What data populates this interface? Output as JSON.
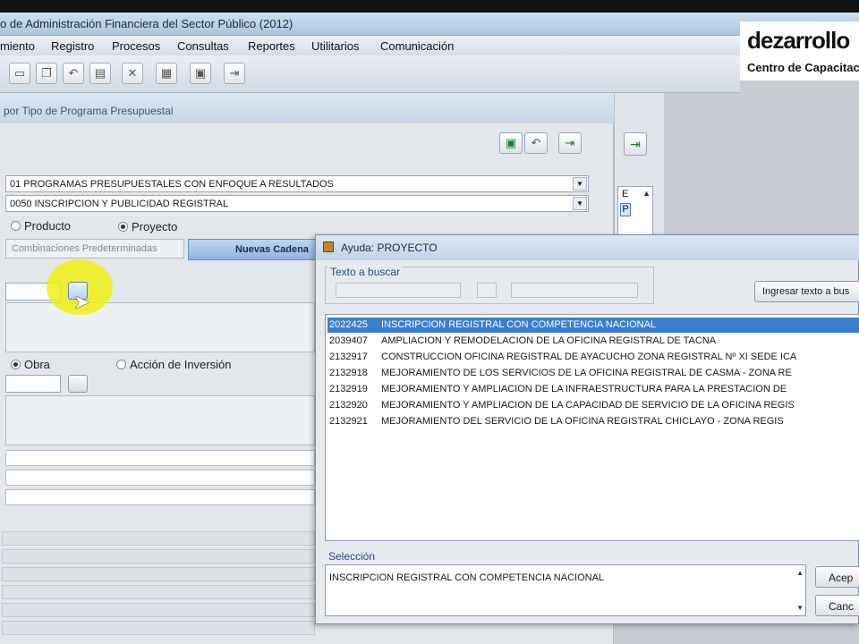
{
  "window": {
    "title": "o de Administración Financiera del Sector Público (2012)"
  },
  "menu": [
    "miento",
    "Registro",
    "Procesos",
    "Consultas",
    "Reportes",
    "Utilitarios",
    "Comunicación"
  ],
  "logo": {
    "name": "dezarrollo",
    "tagline": "Centro de Capacitaci"
  },
  "form": {
    "title": "por Tipo de Programa Presupuestal",
    "combo1": "01 PROGRAMAS PRESUPUESTALES CON ENFOQUE A RESULTADOS",
    "combo2": "0050 INSCRIPCION Y PUBLICIDAD REGISTRAL",
    "radio_producto": "Producto",
    "radio_proyecto": "Proyecto",
    "tab_combinaciones": "Combinaciones Predeterminadas",
    "tab_nuevas": "Nuevas Cadena",
    "radio_obra": "Obra",
    "radio_accion": "Acción de Inversión"
  },
  "side": {
    "letter1": "E",
    "letter2": "P"
  },
  "dialog": {
    "title": "Ayuda: PROYECTO",
    "search_label": "Texto a buscar",
    "search_button": "Ingresar texto a bus",
    "items": [
      {
        "code": "2022425",
        "text": "INSCRIPCION REGISTRAL CON COMPETENCIA NACIONAL"
      },
      {
        "code": "2039407",
        "text": "AMPLIACION Y REMODELACION DE LA OFICINA REGISTRAL DE TACNA"
      },
      {
        "code": "2132917",
        "text": "CONSTRUCCION OFICINA REGISTRAL DE AYACUCHO ZONA REGISTRAL Nº XI SEDE ICA"
      },
      {
        "code": "2132918",
        "text": "MEJORAMIENTO DE LOS SERVICIOS DE LA OFICINA REGISTRAL DE CASMA - ZONA RE"
      },
      {
        "code": "2132919",
        "text": "MEJORAMIENTO Y AMPLIACION DE LA INFRAESTRUCTURA PARA LA PRESTACION DE"
      },
      {
        "code": "2132920",
        "text": "MEJORAMIENTO Y AMPLIACION DE LA CAPACIDAD DE SERVICIO DE LA OFICINA REGIS"
      },
      {
        "code": "2132921",
        "text": "MEJORAMIENTO DEL SERVICIO DE LA OFICINA REGISTRAL CHICLAYO - ZONA REGIS"
      }
    ],
    "selection_label": "Selección",
    "selection_value": "INSCRIPCION REGISTRAL CON COMPETENCIA NACIONAL",
    "accept_button": "Acep",
    "cancel_button": "Canc"
  },
  "colors": {
    "selection": "#3b7fd4",
    "highlight": "#f0f014"
  }
}
